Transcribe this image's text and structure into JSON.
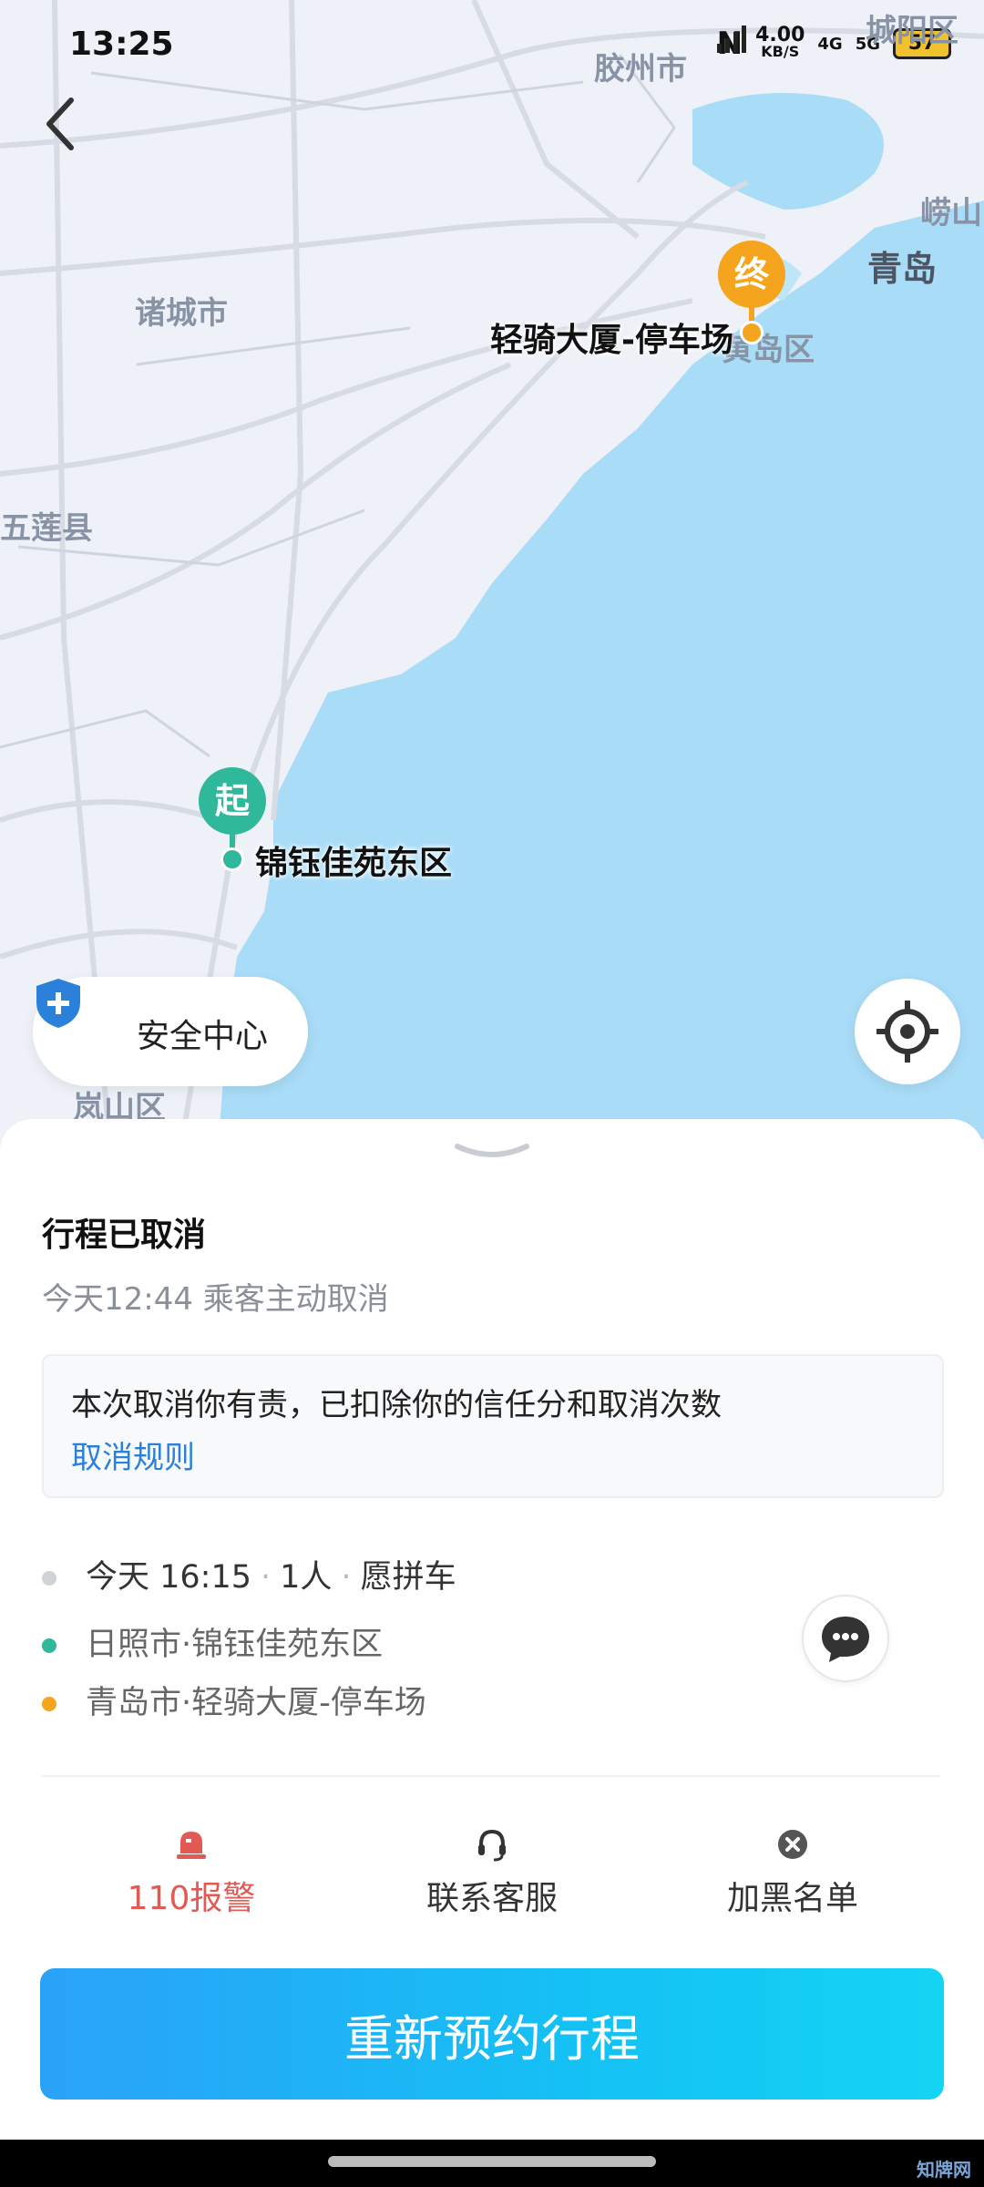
{
  "status_bar": {
    "time": "13:25",
    "nfc": "N",
    "speed_value": "4.00",
    "speed_unit": "KB/S",
    "net1": "4G",
    "net2": "5G",
    "battery": "57"
  },
  "map": {
    "labels": [
      "胶州市",
      "城阳区",
      "崂山",
      "青岛",
      "诸城市",
      "五莲县",
      "黄岛区",
      "岚山区"
    ],
    "origin": {
      "pin": "起",
      "name": "锦钰佳苑东区"
    },
    "destination": {
      "pin": "终",
      "name": "轻骑大厦-停车场"
    }
  },
  "safety": {
    "label": "安全中心"
  },
  "trip": {
    "title": "行程已取消",
    "subtitle": "今天12:44 乘客主动取消",
    "notice": "本次取消你有责，已扣除你的信任分和取消次数",
    "notice_link": "取消规则",
    "time": "今天 16:15",
    "passengers": "1人",
    "carpool": "愿拼车",
    "from": "日照市·锦钰佳苑东区",
    "to": "青岛市·轻骑大厦-停车场"
  },
  "actions": {
    "police": "110报警",
    "support": "联系客服",
    "blacklist": "加黑名单"
  },
  "primary_button": "重新预约行程",
  "watermark": "知牌网",
  "colors": {
    "origin_green": "#2fb89a",
    "destination_orange": "#f5a51d",
    "link_blue": "#2b80d9",
    "alert_red": "#e15a54",
    "sea": "#a9dcf7"
  }
}
